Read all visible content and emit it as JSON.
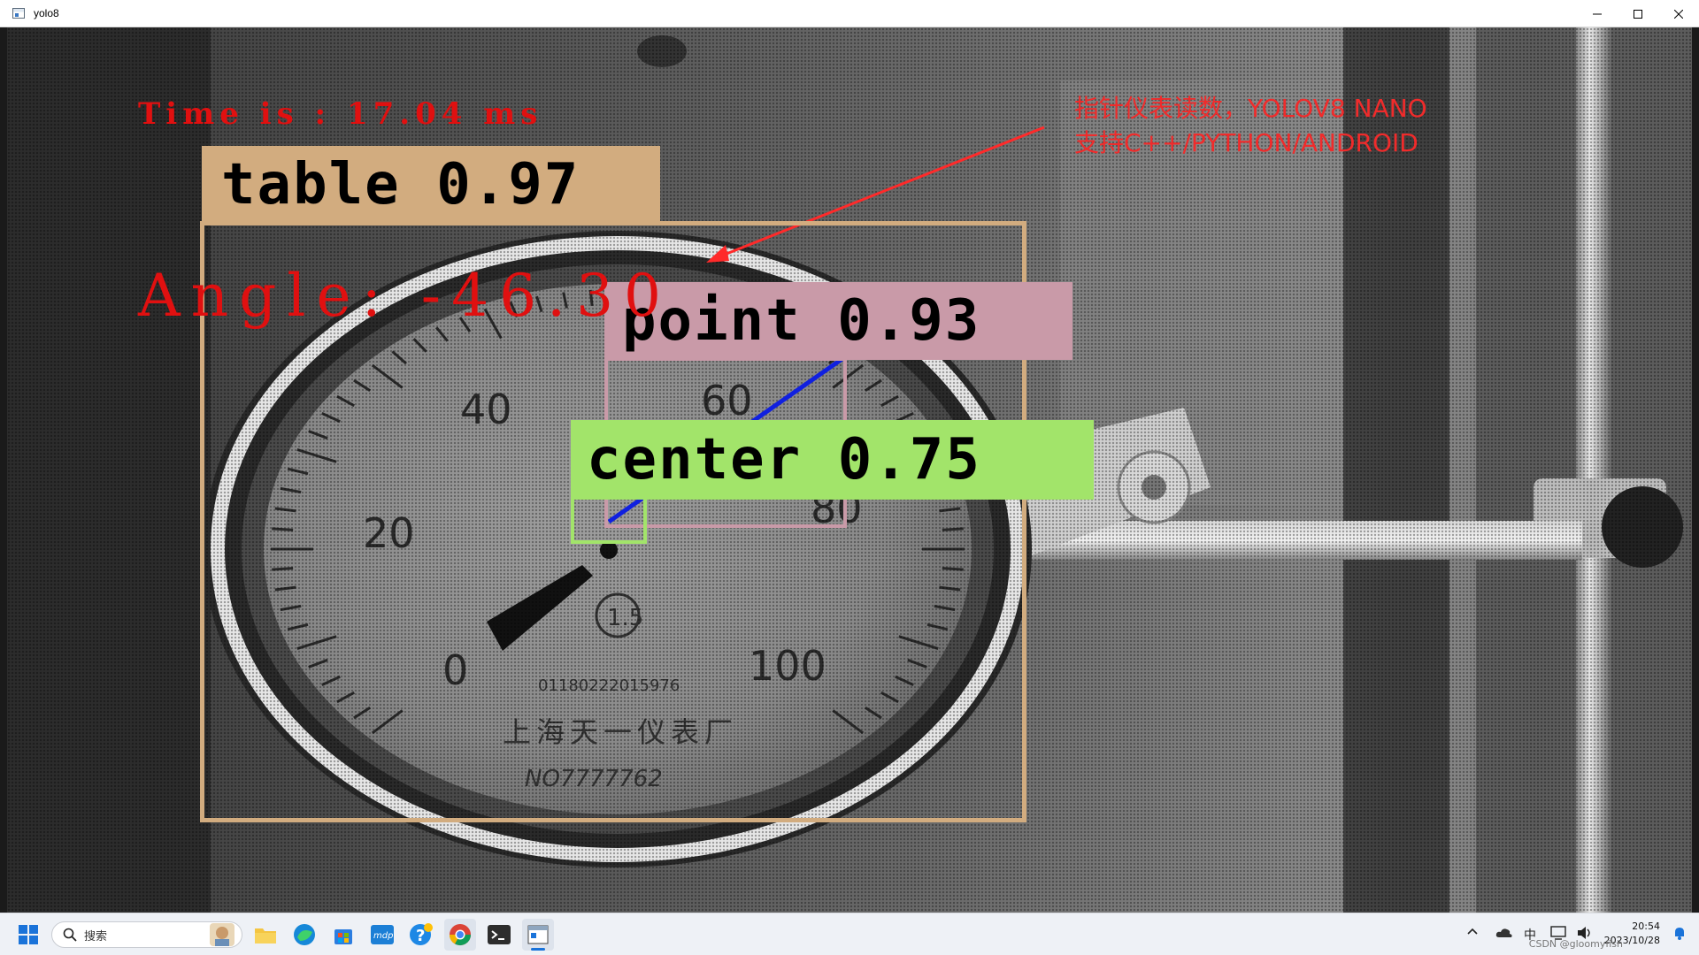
{
  "window": {
    "title": "yolo8",
    "controls": [
      "minimize",
      "maximize",
      "close"
    ]
  },
  "overlay": {
    "time_text": "Time is : 17.04 ms",
    "angle_text": "Angle: -46.30",
    "note_line1": "指针仪表读数，YOLOV8 NANO",
    "note_line2": "支持C++/PYTHON/ANDROID"
  },
  "gauge": {
    "dial_labels": [
      "0",
      "20",
      "40",
      "60",
      "80",
      "100"
    ],
    "accuracy_class": "1.5",
    "serial": "01180222015976",
    "maker": "上海天一仪表厂",
    "number": "NO7777762"
  },
  "detections": [
    {
      "label": "table",
      "score": "0.97",
      "color": "#d2ac7f"
    },
    {
      "label": "point",
      "score": "0.93",
      "color": "#c99aa8"
    },
    {
      "label": "center",
      "score": "0.75",
      "color": "#a2e46a"
    }
  ],
  "colors": {
    "annotation_red": "#e01010",
    "pointer_line": "#1020e0"
  },
  "taskbar": {
    "search_placeholder": "搜索",
    "pinned_apps": [
      "windows-start",
      "file-explorer",
      "edge",
      "store",
      "mdp",
      "help",
      "chrome",
      "terminal",
      "yolo8-window"
    ],
    "tray_ime": "中",
    "clock_time": "20:54",
    "clock_date": "2023/10/28",
    "watermark": "CSDN @gloomyfish"
  }
}
